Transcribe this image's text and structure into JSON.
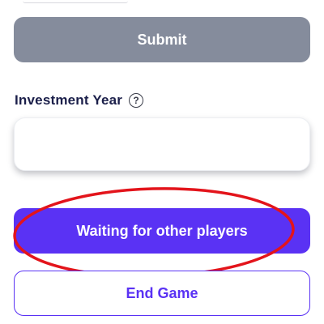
{
  "form": {
    "submit_label": "Submit",
    "investment_year": {
      "label": "Investment Year",
      "help_icon": "question-circle-icon",
      "help_glyph": "?",
      "value": ""
    }
  },
  "actions": {
    "waiting_label": "Waiting for other players",
    "end_game_label": "End Game"
  },
  "colors": {
    "primary": "#5a32f4",
    "disabled": "#858c9c",
    "label": "#1b1f4a",
    "annotation": "#e3141b"
  }
}
